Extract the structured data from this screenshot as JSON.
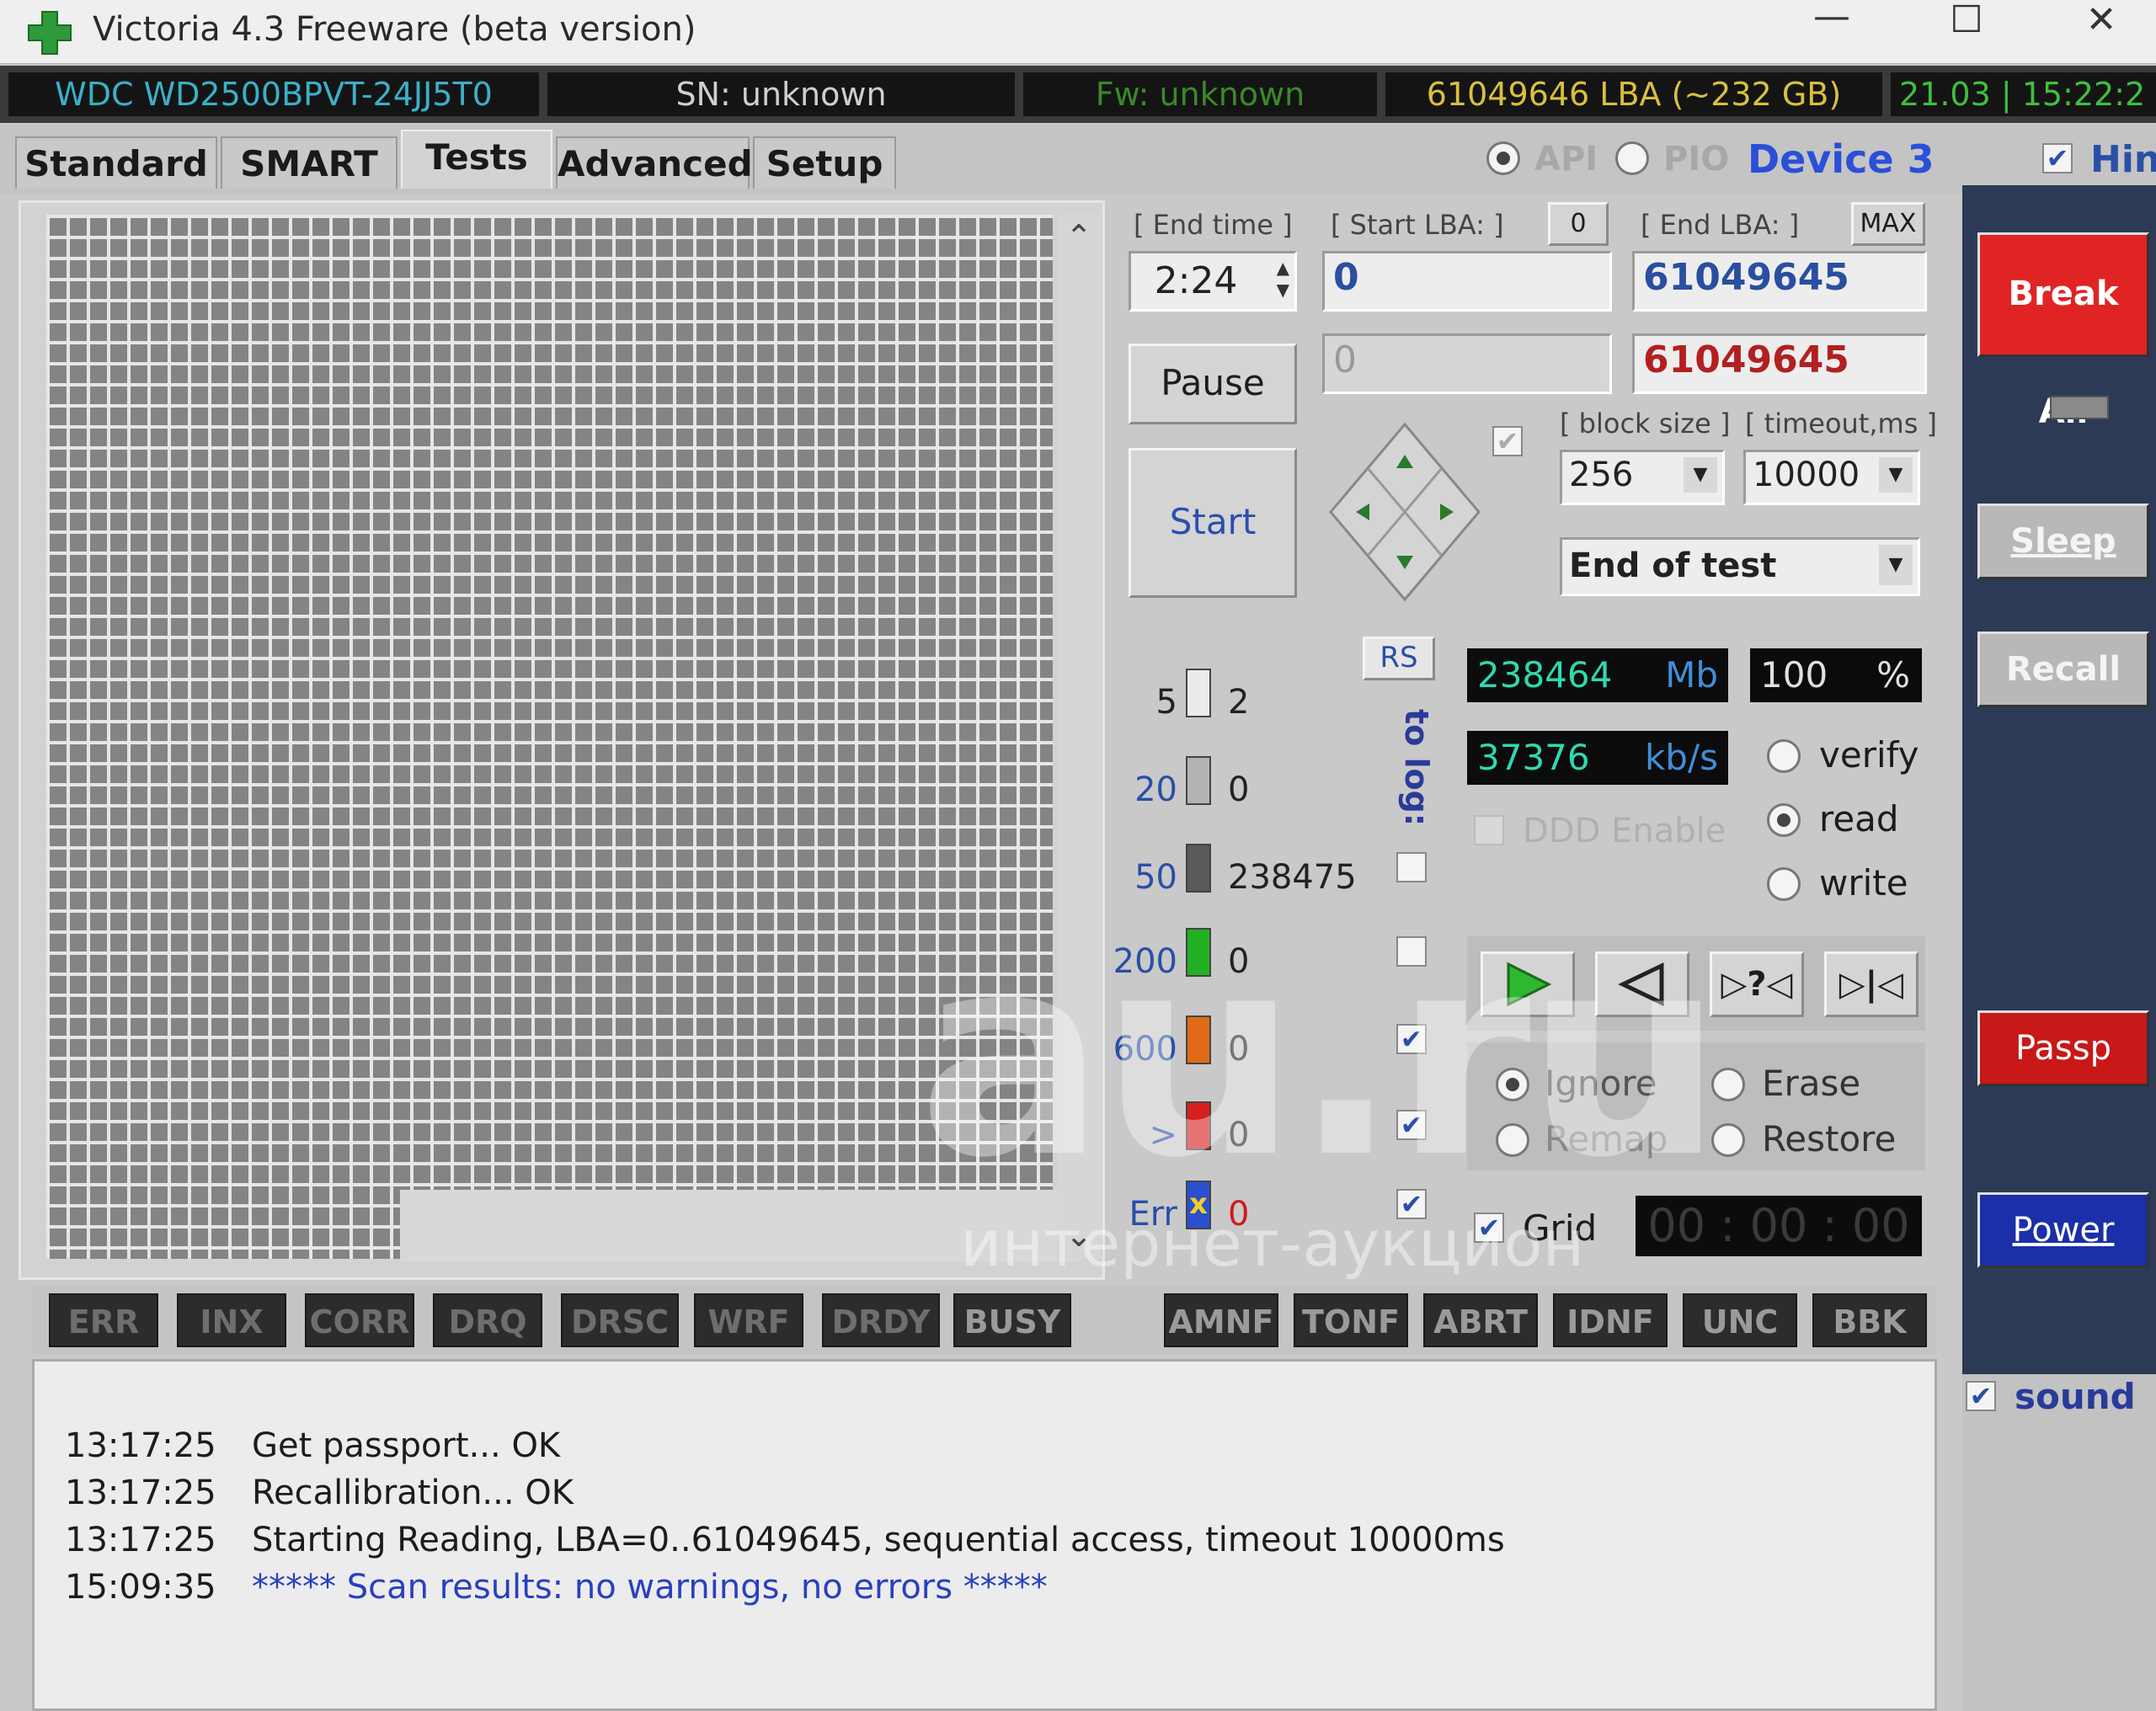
{
  "window": {
    "title": "Victoria 4.3 Freeware (beta version)",
    "minimize": "—",
    "maximize": "☐",
    "close": "✕"
  },
  "info": {
    "model": "WDC WD2500BPVT-24JJ5T0",
    "serial": "SN: unknown",
    "firmware": "Fw: unknown",
    "capacity": "61049646 LBA (~232 GB)",
    "datetime": "21.03 | 15:22:2"
  },
  "tabs": [
    "Standard",
    "SMART",
    "Tests",
    "Advanced",
    "Setup"
  ],
  "access": {
    "api_label": "API",
    "pio_label": "PIO",
    "device": "Device 3",
    "hint_label": "Hint"
  },
  "test": {
    "end_time_label": "[ End time ]",
    "end_time": "2:24",
    "start_lba_label": "[ Start LBA: ]",
    "start_lba_btn": "0",
    "end_lba_label": "[ End LBA: ]",
    "end_lba_btn": "MAX",
    "start_lba": "0",
    "end_lba": "61049645",
    "current_lba": "0",
    "current_end_lba": "61049645",
    "pause_label": "Pause",
    "start_label": "Start",
    "block_size_label": "[ block size ]",
    "timeout_label": "[ timeout,ms ]",
    "block_size": "256",
    "timeout": "10000",
    "end_action": "End of test"
  },
  "legend": {
    "rs_label": "RS",
    "to_log_label": "to log:",
    "items": [
      {
        "threshold": "5",
        "count": "2",
        "color": "#d8d8d8"
      },
      {
        "threshold": "20",
        "count": "0",
        "color": "#a8a8a8"
      },
      {
        "threshold": "50",
        "count": "238475",
        "color": "#5a5a5a"
      },
      {
        "threshold": "200",
        "count": "0",
        "color": "#22b022"
      },
      {
        "threshold": "600",
        "count": "0",
        "color": "#e06a18"
      },
      {
        "threshold": ">",
        "count": "0",
        "color": "#d81e1e"
      },
      {
        "threshold": "Err",
        "count": "0",
        "color": "#2a4fd0"
      }
    ]
  },
  "stats": {
    "mb": "238464",
    "mb_unit": "Mb",
    "percent": "100",
    "percent_unit": "%",
    "speed": "37376",
    "speed_unit": "kb/s",
    "ddd_label": "DDD Enable",
    "mode_verify": "verify",
    "mode_read": "read",
    "mode_write": "write",
    "nav_unknown": "?",
    "action_ignore": "Ignore",
    "action_erase": "Erase",
    "action_remap": "Remap",
    "action_restore": "Restore",
    "grid_label": "Grid",
    "timer": "00 : 00 : 00"
  },
  "flags": {
    "left": [
      "ERR",
      "INX",
      "CORR",
      "DRQ",
      "DRSC",
      "WRF",
      "DRDY",
      "BUSY"
    ],
    "right": [
      "AMNF",
      "TONF",
      "ABRT",
      "IDNF",
      "UNC",
      "BBK"
    ]
  },
  "log": [
    {
      "time": "13:17:25",
      "msg": "Get passport... OK",
      "color": "#222222"
    },
    {
      "time": "13:17:25",
      "msg": "Recallibration... OK",
      "color": "#222222"
    },
    {
      "time": "13:17:25",
      "msg": "Starting Reading, LBA=0..61049645, sequential access, timeout 10000ms",
      "color": "#222222"
    },
    {
      "time": "15:09:35",
      "msg": "***** Scan results: no warnings, no errors *****",
      "color": "#2a3fc0"
    }
  ],
  "side": {
    "break_all": "Break All",
    "sleep": "Sleep",
    "recall": "Recall",
    "passp": "Passp",
    "power": "Power",
    "sound": "sound"
  },
  "watermark": {
    "main": "au.ru",
    "sub": "интернет-аукцион"
  },
  "colors": {
    "break_all": "#e02424",
    "passp": "#c81818",
    "power": "#1a2fa8",
    "device": "#2a4fd8",
    "lcd_text": "#2fd9b0"
  }
}
